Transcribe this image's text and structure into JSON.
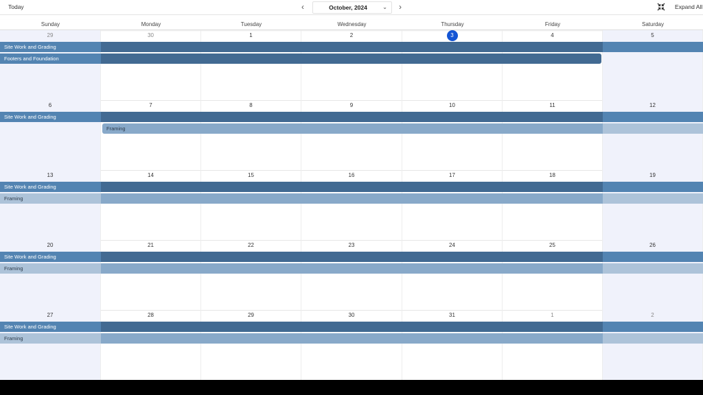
{
  "toolbar": {
    "today_label": "Today",
    "month_label": "October, 2024",
    "expand_label": "Expand All",
    "prev_icon": "chevron-left-icon",
    "next_icon": "chevron-right-icon",
    "collapse_icon": "collapse-arrows-icon"
  },
  "weekdays": [
    "Sunday",
    "Monday",
    "Tuesday",
    "Wednesday",
    "Thursday",
    "Friday",
    "Saturday"
  ],
  "colors": {
    "site_weekday": "#426a92",
    "site_weekend": "#5384b2",
    "framing_weekday": "#88a9c9",
    "framing_weekend": "#adc3d9",
    "footers": "#426a92",
    "today": "#1455d4"
  },
  "weeks": [
    {
      "days": [
        "29",
        "30",
        "1",
        "2",
        "3",
        "4",
        "5"
      ],
      "other_month": [
        true,
        true,
        false,
        false,
        false,
        false,
        false
      ],
      "events": [
        {
          "title": "Site Work and Grading",
          "kind": "site",
          "start": 0,
          "end": 6
        },
        {
          "title": "Footers and Foundation",
          "kind": "footers",
          "start": 0,
          "end": 5
        }
      ]
    },
    {
      "days": [
        "6",
        "7",
        "8",
        "9",
        "10",
        "11",
        "12"
      ],
      "other_month": [
        false,
        false,
        false,
        false,
        false,
        false,
        false
      ],
      "events": [
        {
          "title": "Site Work and Grading",
          "kind": "site",
          "start": 0,
          "end": 6
        },
        {
          "title": "Framing",
          "kind": "framing",
          "start": 1,
          "end": 6
        }
      ]
    },
    {
      "days": [
        "13",
        "14",
        "15",
        "16",
        "17",
        "18",
        "19"
      ],
      "other_month": [
        false,
        false,
        false,
        false,
        false,
        false,
        false
      ],
      "events": [
        {
          "title": "Site Work and Grading",
          "kind": "site",
          "start": 0,
          "end": 6
        },
        {
          "title": "Framing",
          "kind": "framing",
          "start": 0,
          "end": 6
        }
      ]
    },
    {
      "days": [
        "20",
        "21",
        "22",
        "23",
        "24",
        "25",
        "26"
      ],
      "other_month": [
        false,
        false,
        false,
        false,
        false,
        false,
        false
      ],
      "events": [
        {
          "title": "Site Work and Grading",
          "kind": "site",
          "start": 0,
          "end": 6
        },
        {
          "title": "Framing",
          "kind": "framing",
          "start": 0,
          "end": 6
        }
      ]
    },
    {
      "days": [
        "27",
        "28",
        "29",
        "30",
        "31",
        "1",
        "2"
      ],
      "other_month": [
        false,
        false,
        false,
        false,
        false,
        true,
        true
      ],
      "events": [
        {
          "title": "Site Work and Grading",
          "kind": "site",
          "start": 0,
          "end": 6
        },
        {
          "title": "Framing",
          "kind": "framing",
          "start": 0,
          "end": 6
        }
      ]
    }
  ],
  "today": {
    "week": 0,
    "day": 4
  }
}
